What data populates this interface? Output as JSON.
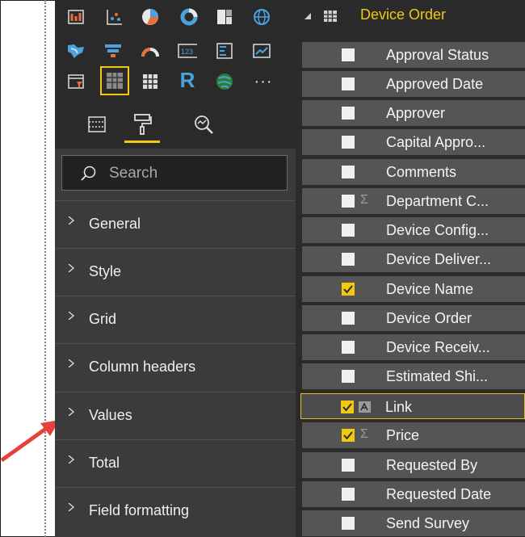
{
  "visualizations": {
    "tabs": [
      {
        "name": "fields-tab"
      },
      {
        "name": "format-tab"
      },
      {
        "name": "analytics-tab"
      }
    ]
  },
  "search": {
    "placeholder": "Search"
  },
  "format_sections": [
    "General",
    "Style",
    "Grid",
    "Column headers",
    "Values",
    "Total",
    "Field formatting"
  ],
  "fields_pane": {
    "table_name": "Device Order",
    "fields": [
      {
        "label": "Approval Status",
        "checked": false,
        "type": "text"
      },
      {
        "label": "Approved Date",
        "checked": false,
        "type": "text"
      },
      {
        "label": "Approver",
        "checked": false,
        "type": "text"
      },
      {
        "label": "Capital Appro...",
        "checked": false,
        "type": "text"
      },
      {
        "label": "Comments",
        "checked": false,
        "type": "text"
      },
      {
        "label": "Department C...",
        "checked": false,
        "type": "sum"
      },
      {
        "label": "Device Config...",
        "checked": false,
        "type": "text"
      },
      {
        "label": "Device Deliver...",
        "checked": false,
        "type": "text"
      },
      {
        "label": "Device Name",
        "checked": true,
        "type": "text"
      },
      {
        "label": "Device Order",
        "checked": false,
        "type": "text"
      },
      {
        "label": "Device Receiv...",
        "checked": false,
        "type": "text"
      },
      {
        "label": "Estimated Shi...",
        "checked": false,
        "type": "text"
      },
      {
        "label": "Link",
        "checked": true,
        "type": "link"
      },
      {
        "label": "Price",
        "checked": true,
        "type": "sum"
      },
      {
        "label": "Requested By",
        "checked": false,
        "type": "text"
      },
      {
        "label": "Requested Date",
        "checked": false,
        "type": "text"
      },
      {
        "label": "Send Survey",
        "checked": false,
        "type": "text"
      }
    ]
  },
  "colors": {
    "accent": "#f2c811",
    "arrow": "#e8403a"
  }
}
